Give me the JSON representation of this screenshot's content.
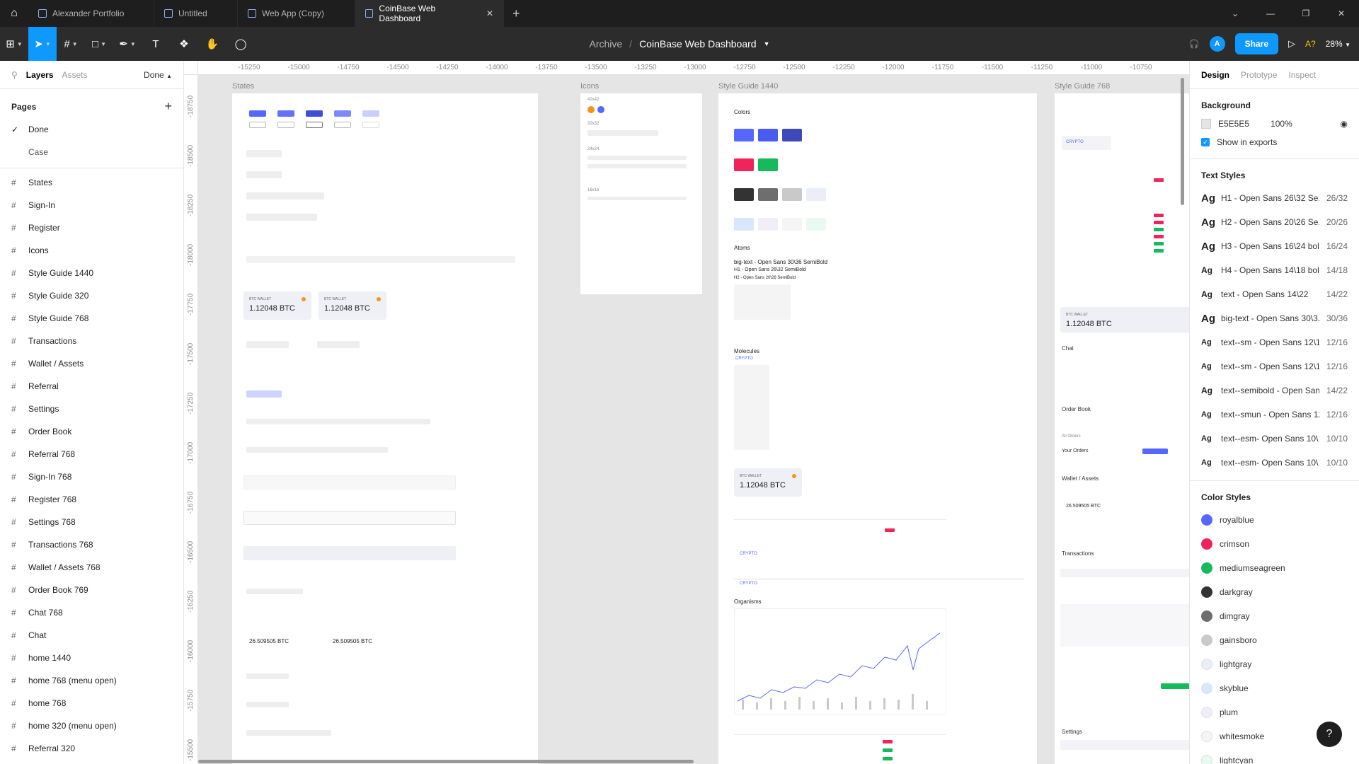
{
  "tabs": [
    {
      "label": "Alexander Portfolio",
      "active": false
    },
    {
      "label": "Untitled",
      "active": false
    },
    {
      "label": "Web App (Copy)",
      "active": false
    },
    {
      "label": "CoinBase Web Dashboard",
      "active": true
    }
  ],
  "breadcrumb": {
    "project": "Archive",
    "separator": "/",
    "file": "CoinBase Web Dashboard"
  },
  "toolbar": {
    "avatar_letter": "A",
    "share_label": "Share",
    "help_label": "A?",
    "zoom": "28%"
  },
  "left_panel": {
    "tab_layers": "Layers",
    "tab_assets": "Assets",
    "done_label": "Done",
    "pages_title": "Pages",
    "pages": [
      {
        "label": "Done",
        "checked": true
      },
      {
        "label": "Case",
        "checked": false
      }
    ],
    "frames": [
      "States",
      "Sign-In",
      "Register",
      "Icons",
      "Style Guide 1440",
      "Style Guide 320",
      "Style Guide 768",
      "Transactions",
      "Wallet / Assets",
      "Referral",
      "Settings",
      "Order Book",
      "Referral 768",
      "Sign-In 768",
      "Register 768",
      "Settings 768",
      "Transactions 768",
      "Wallet / Assets 768",
      "Order Book 769",
      "Chat 768",
      "Chat",
      "home 1440",
      "home 768 (menu open)",
      "home 768",
      "home 320 (menu open)",
      "Referral 320"
    ]
  },
  "rulers": {
    "top": [
      "-15250",
      "-15000",
      "-14750",
      "-14500",
      "-14250",
      "-14000",
      "-13750",
      "-13500",
      "-13250",
      "-13000",
      "-12750",
      "-12500",
      "-12250",
      "-12000",
      "-11750",
      "-11500",
      "-11250",
      "-11000",
      "-10750"
    ],
    "left": [
      "-18750",
      "-18500",
      "-18250",
      "-18000",
      "-17750",
      "-17500",
      "-17250",
      "-17000",
      "-16750",
      "-16500",
      "-16250",
      "-16000",
      "-15750",
      "-15500"
    ]
  },
  "canvas": {
    "frame_titles": {
      "states": "States",
      "icons": "Icons",
      "sg1440": "Style Guide 1440",
      "sg768": "Style Guide 768"
    },
    "icons_sizes": [
      "42x42",
      "32x32",
      "24x24",
      "16x16"
    ],
    "wallet_value": "1.12048 BTC",
    "wallet_label": "BTC WALLET",
    "bitcoin_value": "26.509505 BTC",
    "sg_headings": {
      "colors": "Colors",
      "atoms": "Atoms",
      "molecules": "Molecules",
      "organisms": "Organisms"
    },
    "atoms_lines": [
      "big-text - Open Sans 30\\36 SemiBold",
      "H1 - Open Sans 26\\32 SemiBold",
      "H2 - Open Sans 20\\26 SemiBold"
    ],
    "crypto_logo": "CRYPTO",
    "sg768_sections": [
      "Chat",
      "Order Book",
      "Wallet / Assets",
      "Transactions",
      "Settings"
    ],
    "your_orders": "Your Orders",
    "all_orders": "All Orders"
  },
  "right_panel": {
    "tabs": [
      "Design",
      "Prototype",
      "Inspect"
    ],
    "background_title": "Background",
    "background_hex": "E5E5E5",
    "background_opacity": "100%",
    "show_exports": "Show in exports",
    "text_styles_title": "Text Styles",
    "text_styles": [
      {
        "name": "H1 - Open Sans 26\\32 Se...",
        "size": "26/32",
        "ag": "lg"
      },
      {
        "name": "H2 - Open Sans 20\\26 Se...",
        "size": "20/26",
        "ag": "lg"
      },
      {
        "name": "H3 - Open Sans 16\\24 bold",
        "size": "16/24",
        "ag": "lg"
      },
      {
        "name": "H4 - Open Sans 14\\18 bold",
        "size": "14/18",
        "ag": "md"
      },
      {
        "name": "text - Open Sans 14\\22",
        "size": "14/22",
        "ag": "md"
      },
      {
        "name": "big-text - Open Sans 30\\3...",
        "size": "30/36",
        "ag": "lg"
      },
      {
        "name": "text--sm - Open Sans 12\\16",
        "size": "12/16",
        "ag": "sm"
      },
      {
        "name": "text--sm - Open Sans 12\\1...",
        "size": "12/16",
        "ag": "sm"
      },
      {
        "name": "text--semibold - Open San...",
        "size": "14/22",
        "ag": "md"
      },
      {
        "name": "text--smun - Open Sans 12...",
        "size": "12/16",
        "ag": "sm"
      },
      {
        "name": "text--esm- Open Sans 10\\1...",
        "size": "10/10",
        "ag": "sm"
      },
      {
        "name": "text--esm- Open Sans 10\\10",
        "size": "10/10",
        "ag": "sm"
      }
    ],
    "color_styles_title": "Color Styles",
    "color_styles": [
      {
        "name": "royalblue",
        "color": "#5468ff"
      },
      {
        "name": "crimson",
        "color": "#f0245b"
      },
      {
        "name": "mediumseagreen",
        "color": "#16b95c"
      },
      {
        "name": "darkgray",
        "color": "#333333"
      },
      {
        "name": "dimgray",
        "color": "#6e6e6e"
      },
      {
        "name": "gainsboro",
        "color": "#c9c9c9"
      },
      {
        "name": "lightgray",
        "color": "#eceef7"
      },
      {
        "name": "skyblue",
        "color": "#d7e7ff"
      },
      {
        "name": "plum",
        "color": "#f1eefc"
      },
      {
        "name": "whitesmoke",
        "color": "#f5f5f5"
      },
      {
        "name": "lightcyan",
        "color": "#e8fbf2"
      }
    ]
  },
  "colors": {
    "accent": "#0d99ff",
    "chrome_dark": "#1e1e1e",
    "toolbar": "#2c2c2c",
    "canvas_bg": "#e5e5e5",
    "royalblue": "#5468ff",
    "crimson": "#f0245b",
    "green": "#16b95c",
    "bitcoin": "#f7931a"
  }
}
